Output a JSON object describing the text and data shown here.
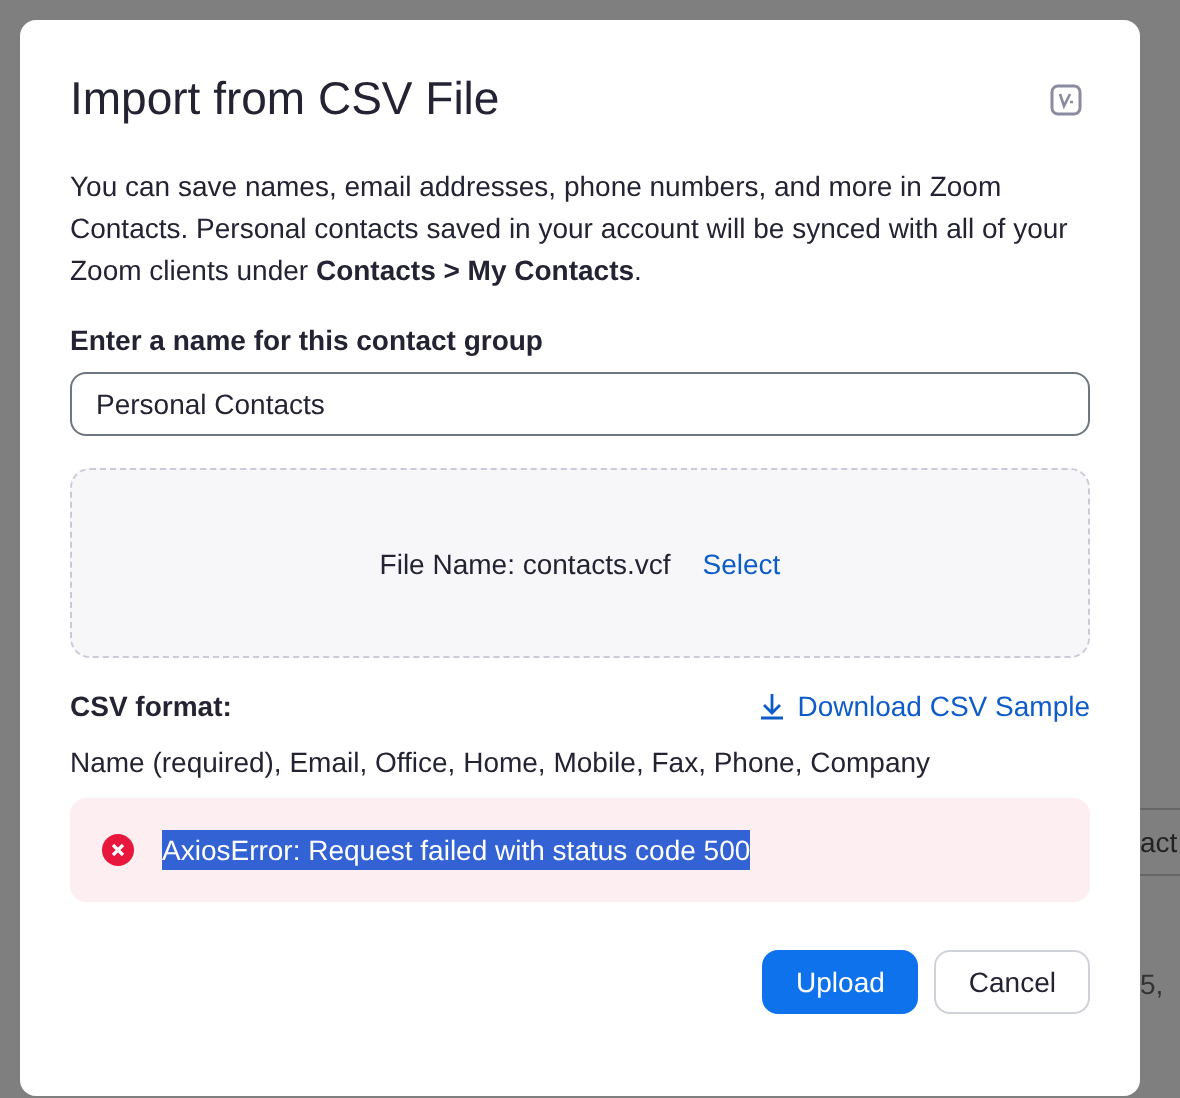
{
  "dialog": {
    "title": "Import from CSV File",
    "description": "You can save names, email addresses, phone numbers, and more in Zoom Contacts. Personal contacts saved in your account will be synced with all of your Zoom clients under **Contacts > My Contacts**.",
    "name_label": "Enter a name for this contact group",
    "name_value": "Personal Contacts",
    "file_label": "File Name: contacts.vcf",
    "select_link": "Select",
    "format_label": "CSV format:",
    "download_link": "Download CSV Sample",
    "format_fields": "Name (required), Email, Office, Home, Mobile, Fax, Phone, Company",
    "error": {
      "message": "AxiosError: Request failed with status code 500",
      "highlighted": true
    },
    "buttons": [
      {
        "label": "Upload",
        "kind": "primary"
      },
      {
        "label": "Cancel",
        "kind": "secondary"
      }
    ]
  },
  "background": {
    "cell_text": "act",
    "line_text": "5,"
  }
}
